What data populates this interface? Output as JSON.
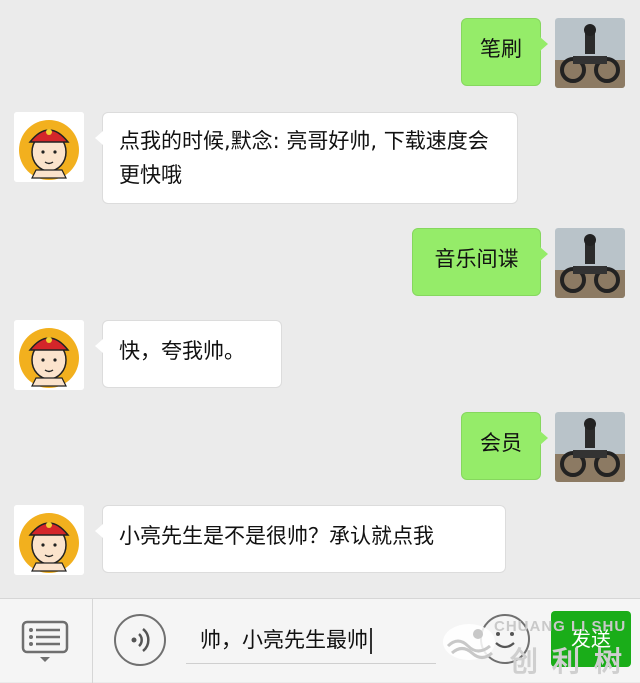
{
  "messages": [
    {
      "side": "out",
      "text": "笔刷"
    },
    {
      "side": "in",
      "text": "点我的时候,默念: 亮哥好帅, 下载速度会更快哦"
    },
    {
      "side": "out",
      "text": "音乐间谍"
    },
    {
      "side": "in",
      "text": "快，夸我帅。"
    },
    {
      "side": "out",
      "text": "会员"
    },
    {
      "side": "in",
      "text": "小亮先生是不是很帅？承认就点我"
    }
  ],
  "input": {
    "value": "帅，小亮先生最帅"
  },
  "send_label": "发送",
  "watermark": {
    "en": "CHUANG LI SHU",
    "cn": "创利树"
  },
  "colors": {
    "bubble_out": "#95ec69",
    "bubble_in": "#ffffff",
    "background": "#ebebeb",
    "send": "#1aad19"
  },
  "icons": {
    "menu": "list-menu-icon",
    "voice": "voice-icon",
    "emoji": "emoji-icon"
  }
}
